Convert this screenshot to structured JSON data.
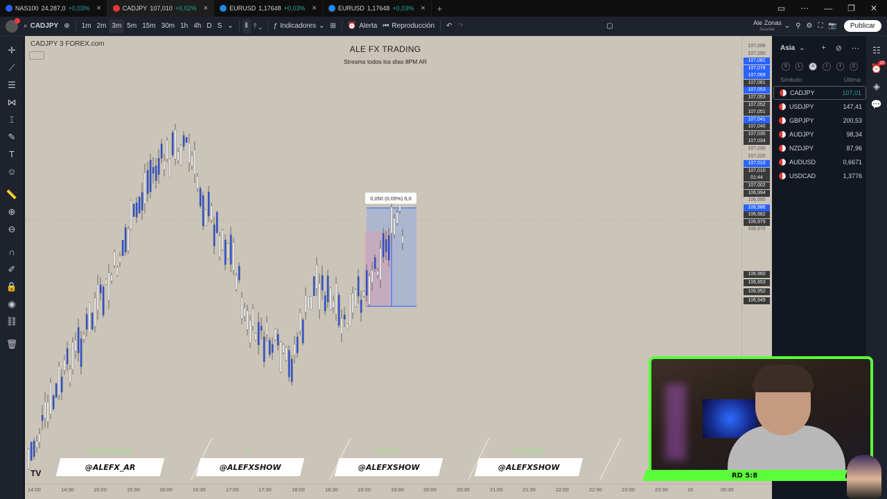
{
  "browser": {
    "tabs": [
      {
        "symbol": "NAS100",
        "price": "24.287,0",
        "change": "+0,03%",
        "color": "#2962ff"
      },
      {
        "symbol": "CADJPY",
        "price": "107,010",
        "change": "+0,02%",
        "color": "#e53935"
      },
      {
        "symbol": "EURUSD",
        "price": "1,17648",
        "change": "+0,03%",
        "color": "#1e88e5"
      },
      {
        "symbol": "EURUSD",
        "price": "1,17648",
        "change": "+0,03%",
        "color": "#1e88e5"
      }
    ]
  },
  "toolbar": {
    "symbol": "CADJPY",
    "intervals": [
      "1m",
      "2m",
      "3m",
      "5m",
      "15m",
      "30m",
      "1h",
      "4h",
      "D",
      "S"
    ],
    "selected_interval": "3m",
    "indicators": "Indicadores",
    "alert": "Alerta",
    "replay": "Reproducción",
    "user_name": "Ale Zonas",
    "user_status": "Guardar",
    "publish": "Publicar"
  },
  "chart": {
    "legend": "CADJPY   3   FOREX.com",
    "stream_title": "ALE FX TRADING",
    "stream_subtitle": "Streams todos los días 8PM AR",
    "measure_label": "0,050 (0,05%) 5,0",
    "socials": [
      {
        "label": "INSTAGRAM",
        "handle": "@ALEFX_AR"
      },
      {
        "label": "X",
        "handle": "@ALEFXSHOW"
      },
      {
        "label": "TIKTOK",
        "handle": "@ALEFXSHOW"
      },
      {
        "label": "YOUTUBE",
        "handle": "@ALEFXSHOW"
      }
    ]
  },
  "price_scale": [
    {
      "v": "107,098",
      "t": "n"
    },
    {
      "v": "107,090",
      "t": "n"
    },
    {
      "v": "107,081",
      "t": "b"
    },
    {
      "v": "107,078",
      "t": "b"
    },
    {
      "v": "107,069",
      "t": "b"
    },
    {
      "v": "107,061",
      "t": "d"
    },
    {
      "v": "107,053",
      "t": "b"
    },
    {
      "v": "107,053",
      "t": "d"
    },
    {
      "v": "107,052",
      "t": "d"
    },
    {
      "v": "107,051",
      "t": "d"
    },
    {
      "v": "107,041",
      "t": "b"
    },
    {
      "v": "107,040",
      "t": "d"
    },
    {
      "v": "107,035",
      "t": "d"
    },
    {
      "v": "107,034",
      "t": "d"
    },
    {
      "v": "107,030",
      "t": "n"
    },
    {
      "v": "107,020",
      "t": "n"
    },
    {
      "v": "107,010",
      "t": "b"
    },
    {
      "v": "107,010",
      "t": "d"
    },
    {
      "v": "01:44",
      "t": "d"
    },
    {
      "v": "107,002",
      "t": "d"
    },
    {
      "v": "106,994",
      "t": "d"
    },
    {
      "v": "106,990",
      "t": "n"
    },
    {
      "v": "106,986",
      "t": "b"
    },
    {
      "v": "106,982",
      "t": "d"
    },
    {
      "v": "106,979",
      "t": "d"
    },
    {
      "v": "106,970",
      "t": "n"
    },
    {
      "v": "106,960",
      "t": "d"
    },
    {
      "v": "106,953",
      "t": "d"
    },
    {
      "v": "106,952",
      "t": "d"
    },
    {
      "v": "106,949",
      "t": "d"
    }
  ],
  "time_scale": [
    "14:00",
    "14:30",
    "15:00",
    "15:30",
    "16:00",
    "16:30",
    "17:00",
    "17:30",
    "18:00",
    "18:30",
    "19:00",
    "19:30",
    "20:00",
    "20:30",
    "21:00",
    "21:30",
    "22:00",
    "22:30",
    "23:00",
    "23:30",
    "16",
    "00:30"
  ],
  "watchlist": {
    "title": "Asia",
    "filters": [
      "S",
      "L",
      "A",
      "I",
      "I",
      "C"
    ],
    "col_symbol": "Símbolo",
    "col_last": "Última",
    "rows": [
      {
        "symbol": "CADJPY",
        "price": "107,01",
        "selected": true
      },
      {
        "symbol": "USDJPY",
        "price": "147,41",
        "selected": false
      },
      {
        "symbol": "GBPJPY",
        "price": "200,53",
        "selected": false
      },
      {
        "symbol": "AUDJPY",
        "price": "98,34",
        "selected": false
      },
      {
        "symbol": "NZDJPY",
        "price": "87,96",
        "selected": false
      },
      {
        "symbol": "AUDUSD",
        "price": "0,6671",
        "selected": false
      },
      {
        "symbol": "USDCAD",
        "price": "1,3776",
        "selected": false
      }
    ]
  },
  "right_badge": "10",
  "webcam": {
    "caption": "RD 5:8"
  }
}
